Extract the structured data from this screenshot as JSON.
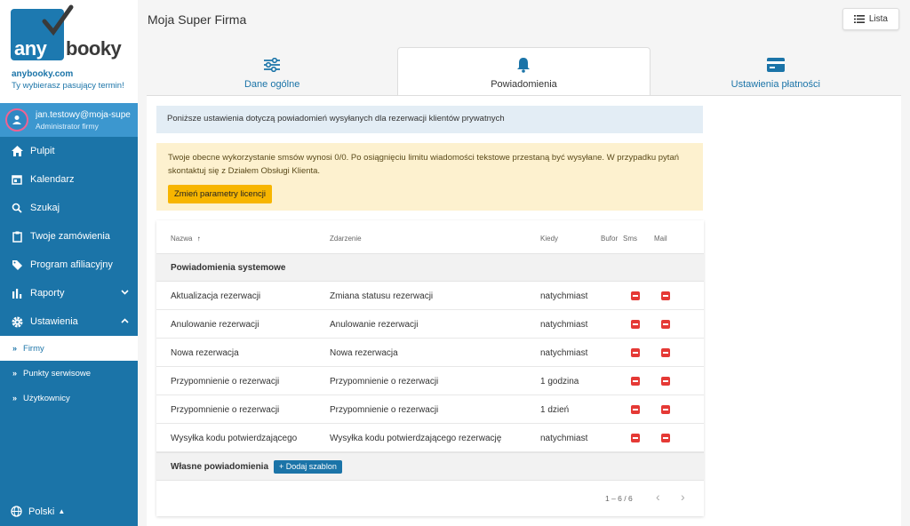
{
  "brand": {
    "logo_any": "any",
    "logo_booky": "booky",
    "site": "anybooky.com",
    "tagline": "Ty wybierasz pasujący termin!"
  },
  "user": {
    "email": "jan.testowy@moja-supe",
    "role": "Administrator firmy"
  },
  "nav": {
    "items": [
      {
        "label": "Pulpit",
        "icon": "home-icon"
      },
      {
        "label": "Kalendarz",
        "icon": "calendar-icon"
      },
      {
        "label": "Szukaj",
        "icon": "search-icon"
      },
      {
        "label": "Twoje zamówienia",
        "icon": "clipboard-icon"
      },
      {
        "label": "Program afiliacyjny",
        "icon": "tag-icon"
      },
      {
        "label": "Raporty",
        "icon": "bar-chart-icon"
      },
      {
        "label": "Ustawienia",
        "icon": "gear-icon"
      }
    ],
    "sub_items": [
      {
        "label": "Firmy"
      },
      {
        "label": "Punkty serwisowe"
      },
      {
        "label": "Użytkownicy"
      }
    ],
    "language": "Polski"
  },
  "header": {
    "title": "Moja Super Firma",
    "list_button": "Lista"
  },
  "tabs": [
    {
      "label": "Dane ogólne",
      "icon": "sliders-icon"
    },
    {
      "label": "Powiadomienia",
      "icon": "bell-icon"
    },
    {
      "label": "Ustawienia płatności",
      "icon": "credit-card-icon"
    }
  ],
  "info_text": "Poniższe ustawienia dotyczą powiadomień wysyłanych dla rezerwacji klientów prywatnych",
  "warning": {
    "text": "Twoje obecne wykorzystanie smsów wynosi 0/0. Po osiągnięciu limitu wiadomości tekstowe przestaną być wysyłane. W przypadku pytań skontaktuj się z Działem Obsługi Klienta.",
    "button": "Zmień parametry licencji"
  },
  "table": {
    "headers": {
      "name": "Nazwa",
      "event": "Zdarzenie",
      "when": "Kiedy",
      "buffer": "Bufor",
      "sms": "Sms",
      "mail": "Mail"
    },
    "system_group": "Powiadomienia systemowe",
    "rows": [
      {
        "name": "Aktualizacja rezerwacji",
        "event": "Zmiana statusu rezerwacji",
        "when": "natychmiast"
      },
      {
        "name": "Anulowanie rezerwacji",
        "event": "Anulowanie rezerwacji",
        "when": "natychmiast"
      },
      {
        "name": "Nowa rezerwacja",
        "event": "Nowa rezerwacja",
        "when": "natychmiast"
      },
      {
        "name": "Przypomnienie o rezerwacji",
        "event": "Przypomnienie o rezerwacji",
        "when": "1 godzina"
      },
      {
        "name": "Przypomnienie o rezerwacji",
        "event": "Przypomnienie o rezerwacji",
        "when": "1 dzień"
      },
      {
        "name": "Wysyłka kodu potwierdzającego",
        "event": "Wysyłka kodu potwierdzającego rezerwację",
        "when": "natychmiast"
      }
    ],
    "custom_group": "Własne powiadomienia",
    "add_template": "+ Dodaj szablon",
    "pagination": "1 – 6 / 6"
  },
  "colors": {
    "primary": "#1b74a8",
    "warning_bg": "#fdf1cf",
    "warning_button": "#f7b500",
    "toggle_off": "#e53935"
  }
}
